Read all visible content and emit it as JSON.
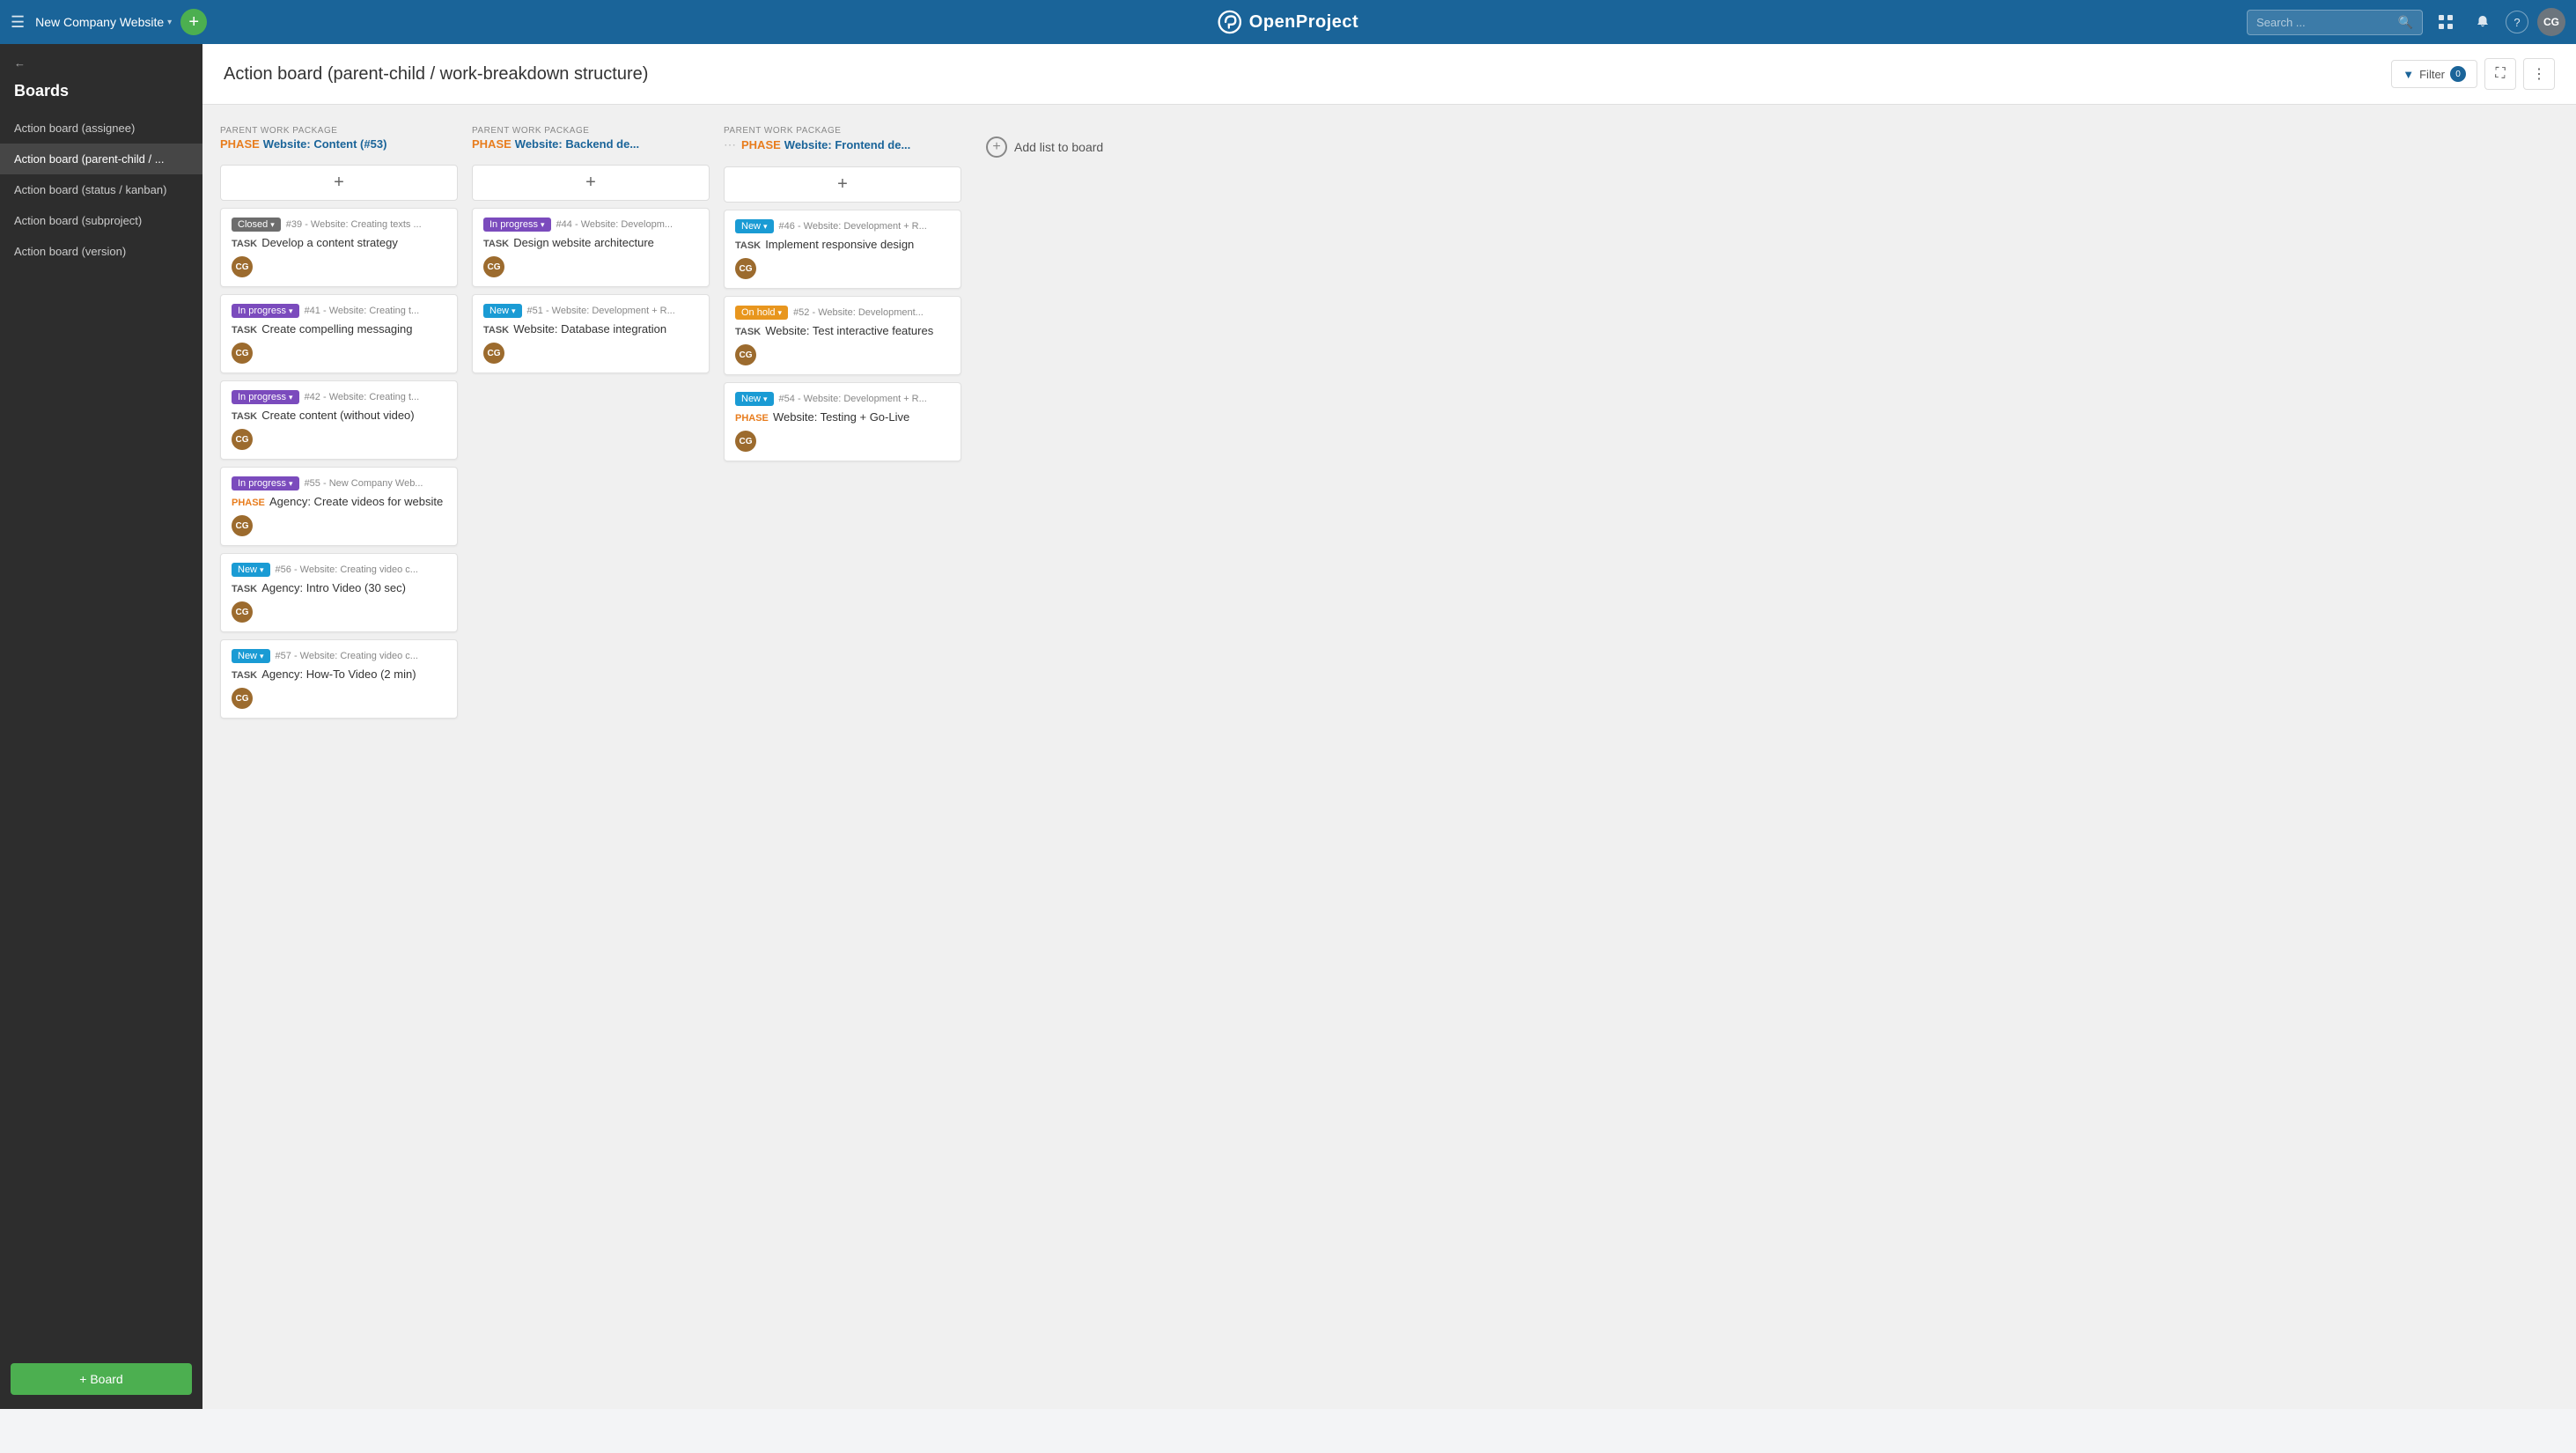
{
  "nav": {
    "hamburger_icon": "☰",
    "project_name": "New Company Website",
    "project_chevron": "▾",
    "plus_icon": "+",
    "logo_text": "OpenProject",
    "search_placeholder": "Search ...",
    "grid_icon": "⊞",
    "bell_icon": "🔔",
    "help_icon": "?",
    "avatar_initials": "CG"
  },
  "sidebar": {
    "back_icon": "←",
    "back_label": "",
    "title": "Boards",
    "items": [
      {
        "id": "action-board-assignee",
        "label": "Action board (assignee)",
        "active": false
      },
      {
        "id": "action-board-parent-child",
        "label": "Action board (parent-child / ...",
        "active": true
      },
      {
        "id": "action-board-status",
        "label": "Action board (status / kanban)",
        "active": false
      },
      {
        "id": "action-board-subproject",
        "label": "Action board (subproject)",
        "active": false
      },
      {
        "id": "action-board-version",
        "label": "Action board (version)",
        "active": false
      }
    ],
    "add_button_label": "+ Board"
  },
  "page": {
    "title": "Action board (parent-child / work-breakdown structure)",
    "filter_label": "Filter",
    "filter_count": "0",
    "filter_icon": "▼",
    "fullscreen_icon": "⛶",
    "more_icon": "⋮"
  },
  "columns": [
    {
      "id": "col-content",
      "type_label": "Parent work package",
      "phase": "PHASE",
      "name": "Website: Content (#53)",
      "cards": [
        {
          "status": "Closed",
          "status_type": "closed",
          "id": "#39",
          "meta": "- Website: Creating texts ...",
          "card_type": "TASK",
          "card_type_style": "task",
          "title": "Develop a content strategy",
          "avatar": "CG"
        },
        {
          "status": "In progress",
          "status_type": "inprogress",
          "id": "#41",
          "meta": "- Website: Creating t...",
          "card_type": "TASK",
          "card_type_style": "task",
          "title": "Create compelling messaging",
          "avatar": "CG"
        },
        {
          "status": "In progress",
          "status_type": "inprogress",
          "id": "#42",
          "meta": "- Website: Creating t...",
          "card_type": "TASK",
          "card_type_style": "task",
          "title": "Create content (without video)",
          "avatar": "CG"
        },
        {
          "status": "In progress",
          "status_type": "inprogress",
          "id": "#55",
          "meta": "- New Company Web...",
          "card_type": "PHASE",
          "card_type_style": "phase",
          "title": "Agency: Create videos for website",
          "avatar": "CG"
        },
        {
          "status": "New",
          "status_type": "new",
          "id": "#56",
          "meta": "- Website: Creating video c...",
          "card_type": "TASK",
          "card_type_style": "task",
          "title": "Agency: Intro Video (30 sec)",
          "avatar": "CG"
        },
        {
          "status": "New",
          "status_type": "new",
          "id": "#57",
          "meta": "- Website: Creating video c...",
          "card_type": "TASK",
          "card_type_style": "task",
          "title": "Agency: How-To Video (2 min)",
          "avatar": "CG"
        }
      ]
    },
    {
      "id": "col-backend",
      "type_label": "Parent work package",
      "phase": "PHASE",
      "name": "Website: Backend de...",
      "cards": [
        {
          "status": "In progress",
          "status_type": "inprogress",
          "id": "#44",
          "meta": "- Website: Developm...",
          "card_type": "TASK",
          "card_type_style": "task",
          "title": "Design website architecture",
          "avatar": "CG"
        },
        {
          "status": "New",
          "status_type": "new",
          "id": "#51",
          "meta": "- Website: Development + R...",
          "card_type": "TASK",
          "card_type_style": "task",
          "title": "Website: Database integration",
          "avatar": "CG"
        }
      ]
    },
    {
      "id": "col-frontend",
      "type_label": "Parent work package",
      "phase": "PHASE",
      "name": "Website: Frontend de...",
      "cards": [
        {
          "status": "New",
          "status_type": "new",
          "id": "#46",
          "meta": "- Website: Development + R...",
          "card_type": "TASK",
          "card_type_style": "task",
          "title": "Implement responsive design",
          "avatar": "CG"
        },
        {
          "status": "On hold",
          "status_type": "onhold",
          "id": "#52",
          "meta": "- Website: Development...",
          "card_type": "TASK",
          "card_type_style": "task",
          "title": "Website: Test interactive features",
          "avatar": "CG"
        },
        {
          "status": "New",
          "status_type": "new",
          "id": "#54",
          "meta": "- Website: Development + R...",
          "card_type": "PHASE",
          "card_type_style": "phase",
          "title": "Website: Testing + Go-Live",
          "avatar": "CG"
        }
      ]
    }
  ],
  "add_list": {
    "icon": "+",
    "label": "Add list to board"
  }
}
